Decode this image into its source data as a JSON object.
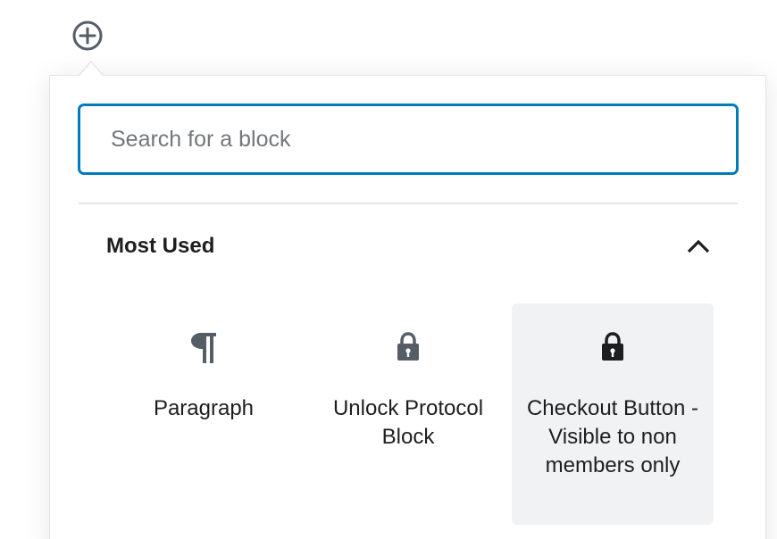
{
  "inserter": {
    "toggle_icon": "plus-circle-icon"
  },
  "search": {
    "placeholder": "Search for a block",
    "value": ""
  },
  "panel": {
    "title": "Most Used",
    "toggle_icon": "chevron-up-icon",
    "expanded": true
  },
  "blocks": [
    {
      "label": "Paragraph",
      "icon": "paragraph-icon",
      "hovered": false
    },
    {
      "label": "Unlock Protocol Block",
      "icon": "lock-icon",
      "hovered": false
    },
    {
      "label": "Checkout Button - Visible to non members only",
      "icon": "lock-icon",
      "hovered": true
    }
  ],
  "colors": {
    "accent": "#007cba",
    "hover_bg": "#f1f2f3",
    "icon": "#555d66",
    "icon_dark": "#1e1e1e"
  }
}
